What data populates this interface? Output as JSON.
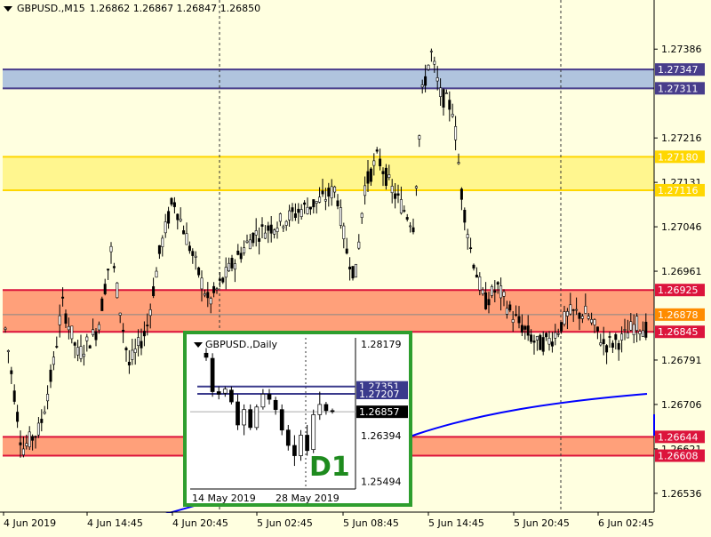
{
  "header": {
    "symbol": "GBPUSD.,M15",
    "ohlc": "1.26862 1.26867 1.26847 1.26850"
  },
  "chart_data": {
    "type": "candlestick",
    "symbol": "GBPUSD.",
    "timeframe": "M15",
    "open": 1.26862,
    "high": 1.26867,
    "low": 1.26847,
    "close": 1.2685,
    "ylim": [
      1.265,
      1.2748
    ],
    "y_ticks": [
      "1.27386",
      "1.27216",
      "1.27131",
      "1.27046",
      "1.26961",
      "1.26791",
      "1.26706",
      "1.26621",
      "1.26536"
    ],
    "x_ticks": [
      "4 Jun 2019",
      "4 Jun 14:45",
      "4 Jun 20:45",
      "5 Jun 02:45",
      "5 Jun 08:45",
      "5 Jun 14:45",
      "5 Jun 20:45",
      "6 Jun 02:45"
    ],
    "zones": [
      {
        "from": 1.27311,
        "to": 1.27347,
        "color": "#B0C4DE",
        "line": "#483D8B",
        "labels": [
          "1.27347",
          "1.27311"
        ],
        "label_color": "#483D8B"
      },
      {
        "from": 1.27116,
        "to": 1.2718,
        "color": "#FFF68F",
        "line": "#FFD700",
        "labels": [
          "1.27180",
          "1.27116"
        ],
        "label_color": "#FFD700"
      },
      {
        "from": 1.26845,
        "to": 1.26925,
        "color": "#FFA07A",
        "line": "#DC143C",
        "labels": [
          "1.26925",
          "1.26845"
        ],
        "label_color": "#DC143C"
      },
      {
        "from": 1.26608,
        "to": 1.26644,
        "color": "#FFA07A",
        "line": "#DC143C",
        "labels": [
          "1.26644",
          "1.26608"
        ],
        "label_color": "#DC143C"
      }
    ],
    "current_price": {
      "value": 1.26878,
      "label": "1.26878",
      "color": "#FF8C00"
    },
    "ma_line": {
      "color": "#0000FF"
    }
  },
  "inset": {
    "header": "GBPUSD.,Daily",
    "badge": "D1",
    "price_ticks": [
      "1.28179",
      "1.26394",
      "1.25494"
    ],
    "zone_labels": [
      "1.27351",
      "1.27207"
    ],
    "current_label": "1.26857",
    "x_ticks": [
      "14 May 2019",
      "28 May 2019"
    ],
    "ylim": [
      1.2535,
      1.283
    ],
    "zones": [
      1.27351,
      1.27207
    ],
    "current": 1.26857
  }
}
